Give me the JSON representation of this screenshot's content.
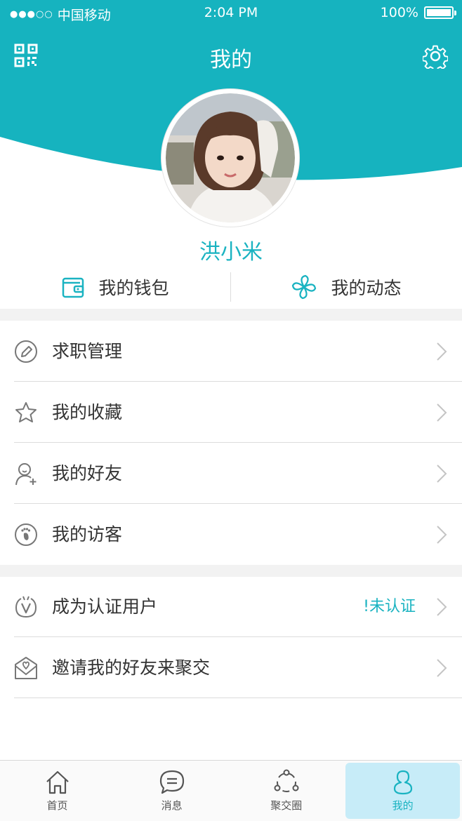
{
  "status_bar": {
    "carrier": "中国移动",
    "time": "2:04 PM",
    "battery": "100%"
  },
  "header": {
    "title": "我的"
  },
  "profile": {
    "name": "洪小米"
  },
  "quick_links": [
    {
      "label": "我的钱包",
      "icon": "wallet-icon"
    },
    {
      "label": "我的动态",
      "icon": "pinwheel-icon"
    }
  ],
  "menu_group_1": [
    {
      "label": "求职管理",
      "icon": "pencil-icon"
    },
    {
      "label": "我的收藏",
      "icon": "star-icon"
    },
    {
      "label": "我的好友",
      "icon": "add-friend-icon"
    },
    {
      "label": "我的访客",
      "icon": "footprint-icon"
    }
  ],
  "menu_group_2": [
    {
      "label": "成为认证用户",
      "icon": "verify-icon",
      "status": "!未认证"
    },
    {
      "label": "邀请我的好友来聚交",
      "icon": "invite-mail-icon"
    }
  ],
  "tabbar": [
    {
      "label": "首页",
      "icon": "home-icon"
    },
    {
      "label": "消息",
      "icon": "chat-icon"
    },
    {
      "label": "聚交圈",
      "icon": "circle-icon"
    },
    {
      "label": "我的",
      "icon": "user-icon",
      "active": true
    }
  ],
  "colors": {
    "accent": "#1ab3c1",
    "active_tab_bg": "#c7ecf8",
    "gap_bg": "#f2f2f2"
  }
}
